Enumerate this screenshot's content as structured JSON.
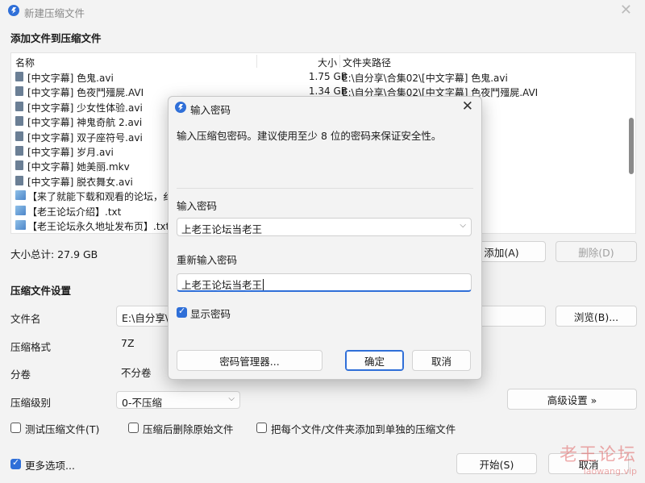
{
  "window": {
    "title": "新建压缩文件"
  },
  "add_section": {
    "heading": "添加文件到压缩文件"
  },
  "file_list": {
    "columns": {
      "name": "名称",
      "size": "大小",
      "path": "文件夹路径"
    },
    "rows": [
      {
        "name": "[中文字幕] 色鬼.avi",
        "size": "1.75 GB",
        "path": "E:\\自分享\\合集02\\[中文字幕] 色鬼.avi",
        "type": "video"
      },
      {
        "name": "[中文字幕] 色夜鬥殭屍.AVI",
        "size": "1.34 GB",
        "path": "E:\\自分享\\合集02\\[中文字幕] 色夜鬥殭屍.AVI",
        "type": "video"
      },
      {
        "name": "[中文字幕] 少女性体验.avi",
        "size": "",
        "path": "女性体验.avi",
        "type": "video"
      },
      {
        "name": "[中文字幕] 神鬼奇航 2.avi",
        "size": "",
        "path": "鬼奇航 2.avi",
        "type": "video"
      },
      {
        "name": "[中文字幕] 双子座符号.avi",
        "size": "",
        "path": "子座符号.avi",
        "type": "video"
      },
      {
        "name": "[中文字幕] 岁月.avi",
        "size": "",
        "path": "月.avi",
        "type": "video"
      },
      {
        "name": "[中文字幕] 她美丽.mkv",
        "size": "",
        "path": "美丽.mkv",
        "type": "video"
      },
      {
        "name": "[中文字幕] 脱衣舞女.avi",
        "size": "",
        "path": "衣舞女.avi",
        "type": "video"
      },
      {
        "name": "【来了就能下载和观看的论坛，纟",
        "size": "",
        "path": "载和观看的论坛，...",
        "type": "txt"
      },
      {
        "name": "【老王论坛介绍】.txt",
        "size": "",
        "path": "坛介绍】.txt",
        "type": "txt"
      },
      {
        "name": "【老王论坛永久地址发布页】.txt",
        "size": "",
        "path": "久地址发布页】.txt",
        "type": "txt"
      }
    ]
  },
  "total_size": "大小总计: 27.9 GB",
  "buttons": {
    "add": "添加(A)",
    "delete": "删除(D)",
    "browse": "浏览(B)...",
    "advanced": "高级设置 »",
    "start": "开始(S)",
    "cancel": "取消"
  },
  "settings": {
    "heading": "压缩文件设置",
    "filename_label": "文件名",
    "filename_value": "E:\\自分享\\",
    "format_label": "压缩格式",
    "format_value": "7Z",
    "volume_label": "分卷",
    "volume_value": "不分卷",
    "level_label": "压缩级别",
    "level_value": "0-不压缩"
  },
  "options": {
    "test": "测试压缩文件(T)",
    "delete_after": "压缩后删除原始文件",
    "separate": "把每个文件/文件夹添加到单独的压缩文件",
    "more": "更多选项..."
  },
  "password_dialog": {
    "title": "输入密码",
    "description": "输入压缩包密码。建议使用至少 8 位的密码来保证安全性。",
    "enter_label": "输入密码",
    "enter_value": "上老王论坛当老王",
    "reenter_label": "重新输入密码",
    "reenter_value": "上老王论坛当老王",
    "show_password": "显示密码",
    "manager_button": "密码管理器...",
    "ok_button": "确定",
    "cancel_button": "取消"
  },
  "watermark": {
    "line1": "老王论坛",
    "line2": "laowang.vip"
  },
  "colors": {
    "accent": "#2f6fd8",
    "watermark": "#dc4646"
  }
}
